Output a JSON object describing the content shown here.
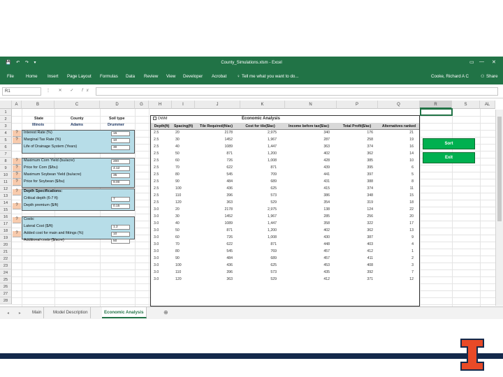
{
  "window": {
    "title": "County_Simulations.xlsm - Excel",
    "user": "Cooke, Richard A C",
    "share": "Share"
  },
  "ribbon": {
    "tabs": [
      "File",
      "Home",
      "Insert",
      "Page Layout",
      "Formulas",
      "Data",
      "Review",
      "View",
      "Developer",
      "Acrobat"
    ],
    "tell_me": "Tell me what you want to do..."
  },
  "formula_bar": {
    "name_box": "R1",
    "formula": ""
  },
  "columns": [
    "A",
    "B",
    "C",
    "D",
    "G",
    "H",
    "I",
    "J",
    "K",
    "N",
    "P",
    "Q",
    "R",
    "S",
    "AL"
  ],
  "rows": [
    "1",
    "2",
    "3",
    "4",
    "5",
    "6",
    "7",
    "8",
    "9",
    "10",
    "11",
    "12",
    "13",
    "14",
    "15",
    "16",
    "17",
    "18",
    "19",
    "20",
    "21",
    "22",
    "23",
    "24",
    "25",
    "26",
    "27",
    "28"
  ],
  "input_panel": {
    "state_label": "State",
    "state_value": "Illinois",
    "county_label": "County",
    "county_value": "Adams",
    "soil_label": "Soil type",
    "soil_value": "Drummer",
    "marker": "?",
    "items": [
      {
        "label": "Interest Rate (%)",
        "value": "15"
      },
      {
        "label": "Marginal Tax Rate (%)",
        "value": "10"
      },
      {
        "label": "Life of Drainage System (Years)",
        "value": "30"
      },
      {
        "label": "Maximum Corn Yield (bu/acre)",
        "value": "200"
      },
      {
        "label": "Price for Corn ($/bu)",
        "value": "4.12"
      },
      {
        "label": "Maximum Soybean Yield (bu/acre)",
        "value": "35"
      },
      {
        "label": "Price for Soybean ($/bu)",
        "value": "9.00"
      }
    ],
    "depth_header": "Depth Specifications:",
    "depth_items": [
      {
        "label": "Critical depth (6-7 ft)",
        "value": "7"
      },
      {
        "label": "Depth premium ($/ft)",
        "value": "0.15"
      }
    ],
    "costs_header": "Costs:",
    "cost_items": [
      {
        "label": "Lateral Cost ($/ft)",
        "value": "1.2"
      },
      {
        "label": "Added cost for main and fittings (%)",
        "value": "10"
      },
      {
        "label": "Additional costs ($/acre)",
        "value": "50"
      }
    ]
  },
  "results": {
    "dwm_label": "DWM",
    "title": "Economic Analysis",
    "headers": [
      "Depth(ft)",
      "Spacing(ft)",
      "Tile Required(ft/ac)",
      "Cost for tile($/ac)",
      "Income before tax($/ac)",
      "Total Profit($/ac)",
      "Alternatives ranked"
    ],
    "rows": [
      [
        "2.5",
        "20",
        "2178",
        "2,975",
        "340",
        "176",
        "21"
      ],
      [
        "2.5",
        "30",
        "1452",
        "1,967",
        "287",
        "258",
        "19"
      ],
      [
        "2.5",
        "40",
        "1089",
        "1,447",
        "363",
        "374",
        "16"
      ],
      [
        "2.5",
        "50",
        "871",
        "1,200",
        "402",
        "362",
        "14"
      ],
      [
        "2.5",
        "60",
        "726",
        "1,008",
        "428",
        "385",
        "10"
      ],
      [
        "2.5",
        "70",
        "622",
        "871",
        "439",
        "395",
        "6"
      ],
      [
        "2.5",
        "80",
        "545",
        "709",
        "441",
        "397",
        "5"
      ],
      [
        "2.5",
        "90",
        "484",
        "689",
        "431",
        "388",
        "8"
      ],
      [
        "2.5",
        "100",
        "436",
        "625",
        "415",
        "374",
        "11"
      ],
      [
        "2.5",
        "110",
        "396",
        "573",
        "386",
        "348",
        "15"
      ],
      [
        "2.5",
        "120",
        "363",
        "529",
        "354",
        "319",
        "18"
      ],
      [
        "3.0",
        "20",
        "2178",
        "2,975",
        "138",
        "124",
        "22"
      ],
      [
        "3.0",
        "30",
        "1452",
        "1,967",
        "285",
        "256",
        "20"
      ],
      [
        "3.0",
        "40",
        "1089",
        "1,447",
        "358",
        "322",
        "17"
      ],
      [
        "3.0",
        "50",
        "871",
        "1,200",
        "402",
        "362",
        "13"
      ],
      [
        "3.0",
        "60",
        "726",
        "1,008",
        "430",
        "387",
        "9"
      ],
      [
        "3.0",
        "70",
        "622",
        "871",
        "448",
        "403",
        "4"
      ],
      [
        "3.0",
        "80",
        "545",
        "769",
        "457",
        "412",
        "1"
      ],
      [
        "3.0",
        "90",
        "484",
        "689",
        "457",
        "411",
        "2"
      ],
      [
        "3.0",
        "100",
        "436",
        "625",
        "453",
        "408",
        "3"
      ],
      [
        "3.0",
        "110",
        "396",
        "573",
        "435",
        "392",
        "7"
      ],
      [
        "3.0",
        "120",
        "363",
        "529",
        "412",
        "371",
        "12"
      ]
    ]
  },
  "buttons": {
    "sort": "Sort",
    "exit": "Exit"
  },
  "sheet_tabs": [
    "Main",
    "Model Description",
    "Economic Analysis"
  ],
  "active_sheet": "Economic Analysis",
  "colors": {
    "excel_green": "#217346",
    "panel_blue": "#b7dde8",
    "marker_orange": "#f8cbad",
    "button_green": "#00b050",
    "university_navy": "#13294b",
    "university_orange": "#e84a27"
  }
}
